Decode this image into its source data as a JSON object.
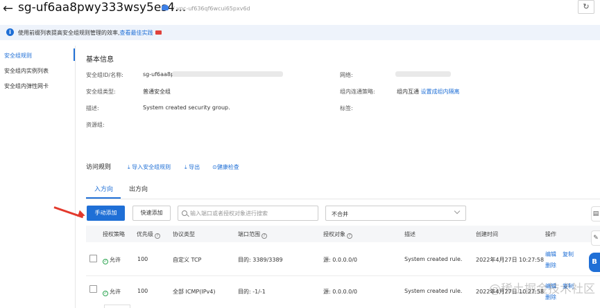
{
  "header": {
    "title": "sg-uf6aa8pwy333wsy5es4...",
    "vpc_link": "/ vpc-uf636qf6wcui65pxv6d",
    "refresh_icon": "refresh-icon"
  },
  "notice": {
    "text": "使用前缀列表提高安全组规则管理的效率,",
    "link": "查看最佳实践"
  },
  "sidebar": {
    "items": [
      {
        "label": "安全组规则",
        "active": true
      },
      {
        "label": "安全组内实例列表",
        "active": false
      },
      {
        "label": "安全组内弹性网卡",
        "active": false
      }
    ]
  },
  "basic_info": {
    "title": "基本信息",
    "id_label": "安全组ID/名称:",
    "id_value": "sg-uf6aa8p",
    "type_label": "安全组类型:",
    "type_value": "普通安全组",
    "desc_label": "描述:",
    "desc_value": "System created security group.",
    "rg_label": "资源组:",
    "network_label": "网络:",
    "policy_label": "组内连通策略:",
    "policy_value": "组内互通",
    "policy_link": "设置成组内隔离",
    "tags_label": "标签:"
  },
  "rules": {
    "title": "访问规则",
    "import": "导入安全组规则",
    "export": "导出",
    "health": "健康检查",
    "tabs": {
      "inbound": "入方向",
      "outbound": "出方向"
    },
    "add_manual": "手动添加",
    "add_quick": "快速添加",
    "search_placeholder": "输入端口或者授权对象进行搜索",
    "merge_select": "不合并",
    "columns": {
      "auth": "授权策略",
      "priority": "优先级",
      "protocol": "协议类型",
      "port": "端口范围",
      "object": "授权对象",
      "desc": "描述",
      "created": "创建时间",
      "ops": "操作"
    },
    "rows": [
      {
        "auth": "允许",
        "priority": "100",
        "protocol": "自定义 TCP",
        "port": "目的: 3389/3389",
        "object": "源: 0.0.0.0/0",
        "desc": "System created rule.",
        "created": "2022年4月27日 10:27:58",
        "edit": "编辑",
        "copy": "复制",
        "delete": "删除"
      },
      {
        "auth": "允许",
        "priority": "100",
        "protocol": "全部 ICMP(IPv4)",
        "port": "目的: -1/-1",
        "object": "源: 0.0.0.0/0",
        "desc": "System created rule.",
        "created": "2022年4月27日 10:27:58",
        "edit": "编辑",
        "copy": "复制",
        "delete": "删除"
      }
    ]
  },
  "watermark": "@稀土掘金技术社区",
  "colors": {
    "primary": "#1f6fd6",
    "arrow": "#e3392c",
    "success": "#2aa44f"
  }
}
